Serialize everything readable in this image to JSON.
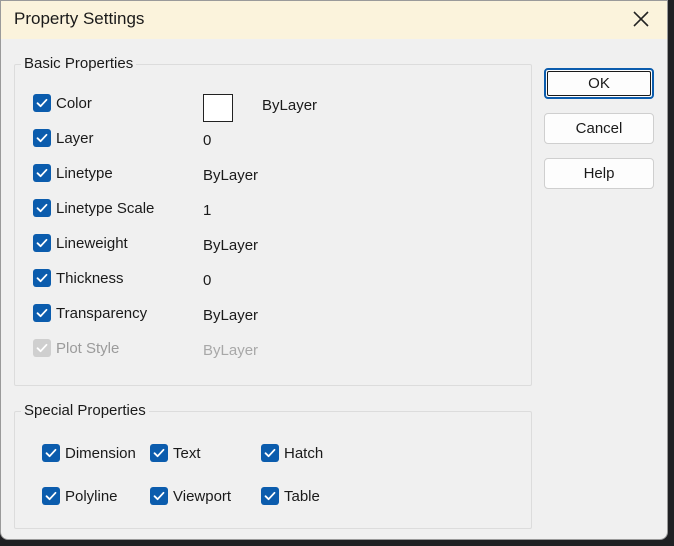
{
  "window": {
    "title": "Property Settings"
  },
  "basic": {
    "title": "Basic Properties",
    "rows": [
      {
        "label": "Color",
        "value": "ByLayer",
        "checked": true,
        "enabled": true,
        "swatch": "#ffffff"
      },
      {
        "label": "Layer",
        "value": "0",
        "checked": true,
        "enabled": true
      },
      {
        "label": "Linetype",
        "value": "ByLayer",
        "checked": true,
        "enabled": true
      },
      {
        "label": "Linetype Scale",
        "value": "1",
        "checked": true,
        "enabled": true
      },
      {
        "label": "Lineweight",
        "value": "ByLayer",
        "checked": true,
        "enabled": true
      },
      {
        "label": "Thickness",
        "value": "0",
        "checked": true,
        "enabled": true
      },
      {
        "label": "Transparency",
        "value": "ByLayer",
        "checked": true,
        "enabled": true
      },
      {
        "label": "Plot Style",
        "value": "ByLayer",
        "checked": true,
        "enabled": false
      }
    ]
  },
  "special": {
    "title": "Special Properties",
    "items": [
      {
        "label": "Dimension",
        "checked": true
      },
      {
        "label": "Text",
        "checked": true
      },
      {
        "label": "Hatch",
        "checked": true
      },
      {
        "label": "Polyline",
        "checked": true
      },
      {
        "label": "Viewport",
        "checked": true
      },
      {
        "label": "Table",
        "checked": true
      }
    ]
  },
  "buttons": {
    "ok": "OK",
    "cancel": "Cancel",
    "help": "Help"
  },
  "colors": {
    "accent": "#0b5cad",
    "titlebar": "#fbf3dc",
    "dialog_bg": "#f0f0f0"
  },
  "icons": {
    "close": "close-icon",
    "check": "check-icon"
  }
}
